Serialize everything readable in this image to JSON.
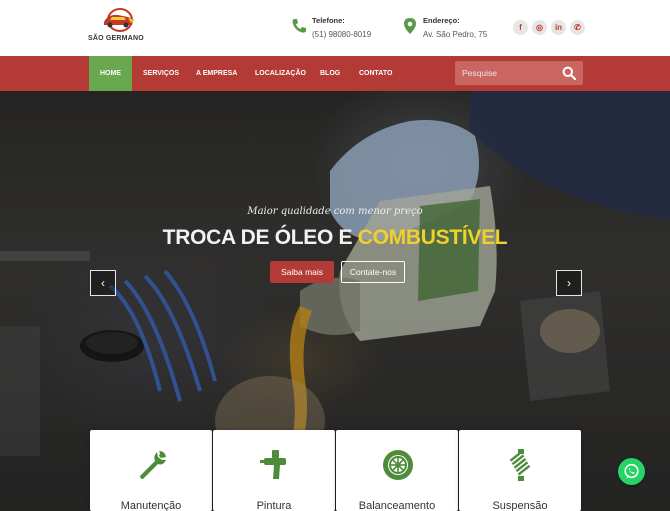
{
  "brand": {
    "name": "SÃO GERMANO",
    "logo_icon": "car-logo-icon"
  },
  "contact": {
    "phone": {
      "label": "Telefone:",
      "value": "(51) 98080-8019",
      "icon": "phone-icon"
    },
    "address": {
      "label": "Endereço:",
      "value": "Av. São Pedro, 75",
      "icon": "map-pin-icon"
    }
  },
  "socials": [
    {
      "name": "facebook",
      "glyph": "f"
    },
    {
      "name": "instagram",
      "glyph": "◎"
    },
    {
      "name": "linkedin",
      "glyph": "in"
    },
    {
      "name": "whatsapp",
      "glyph": "✆"
    }
  ],
  "nav": {
    "items": [
      {
        "label": "HOME",
        "active": true
      },
      {
        "label": "SERVIÇOS",
        "active": false
      },
      {
        "label": "A EMPRESA",
        "active": false
      },
      {
        "label": "LOCALIZAÇÃO",
        "active": false
      },
      {
        "label": "BLOG",
        "active": false
      },
      {
        "label": "CONTATO",
        "active": false
      }
    ],
    "search_placeholder": "Pesquise"
  },
  "hero": {
    "subtitle": "Maior qualidade com menor preço",
    "title_main": "TROCA DE ÓLEO E ",
    "title_highlight": "COMBUSTÍVEL",
    "btn_more": "Saiba mais",
    "btn_contact": "Contate-nos",
    "prev": "‹",
    "next": "›"
  },
  "services": [
    {
      "title": "Manutenção",
      "icon": "wrench-icon"
    },
    {
      "title": "Pintura",
      "icon": "spray-gun-icon"
    },
    {
      "title": "Balanceamento",
      "icon": "wheel-icon"
    },
    {
      "title": "Suspensão",
      "icon": "spring-icon"
    }
  ],
  "colors": {
    "primary": "#b33a35",
    "accent_green": "#6aa84f",
    "highlight": "#f0d02c",
    "whatsapp": "#25d366"
  }
}
